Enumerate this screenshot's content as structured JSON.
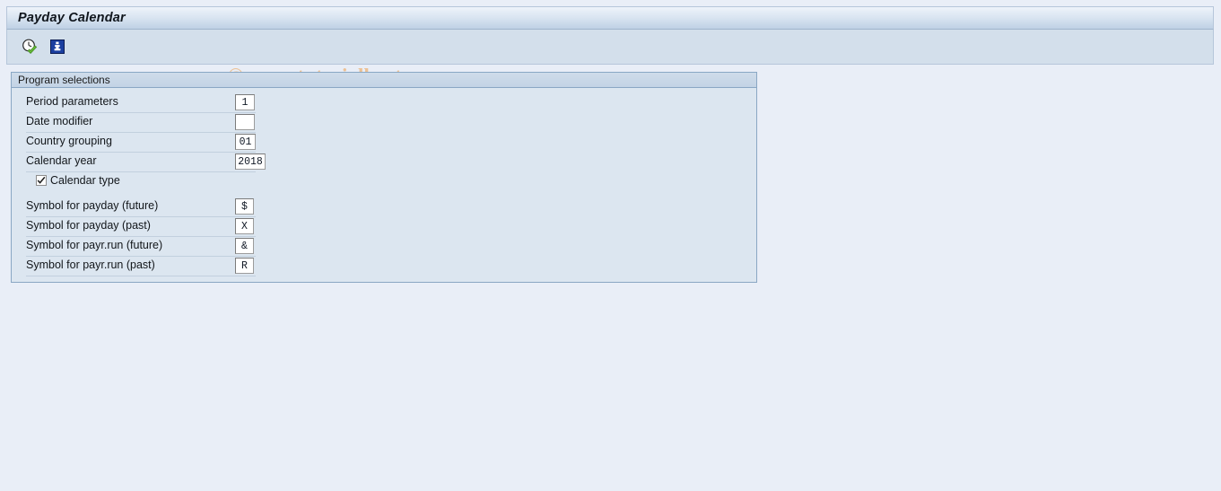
{
  "window": {
    "title": "Payday Calendar"
  },
  "toolbar": {
    "buttons": [
      {
        "name": "execute-icon",
        "tooltip": "Execute"
      },
      {
        "name": "info-icon",
        "tooltip": "Information"
      }
    ]
  },
  "watermark": {
    "text": "© www.tutorialkart.com",
    "color": "#edbe8d"
  },
  "group": {
    "title": "Program selections",
    "rows": [
      {
        "label": "Period parameters",
        "value": "1",
        "field": "text"
      },
      {
        "label": "Date modifier",
        "value": "",
        "field": "text"
      },
      {
        "label": "Country grouping",
        "value": "01",
        "field": "text"
      },
      {
        "label": "Calendar year",
        "value": "2018",
        "field": "text"
      },
      {
        "label": "Calendar type",
        "value": "X",
        "field": "checkbox",
        "checked": true
      },
      {
        "label": "Symbol for payday (future)",
        "value": "$",
        "field": "text"
      },
      {
        "label": "Symbol for payday (past)",
        "value": "X",
        "field": "text"
      },
      {
        "label": "Symbol for payr.run (future)",
        "value": "&",
        "field": "text"
      },
      {
        "label": "Symbol for payr.run (past)",
        "value": "R",
        "field": "text"
      }
    ]
  },
  "colors": {
    "page_background": "#e9eef7",
    "toolbar_background": "#d3dfeb",
    "group_background": "#dce6f0",
    "group_border": "#8aa7c4",
    "accent_blue": "#1b3fa0"
  }
}
